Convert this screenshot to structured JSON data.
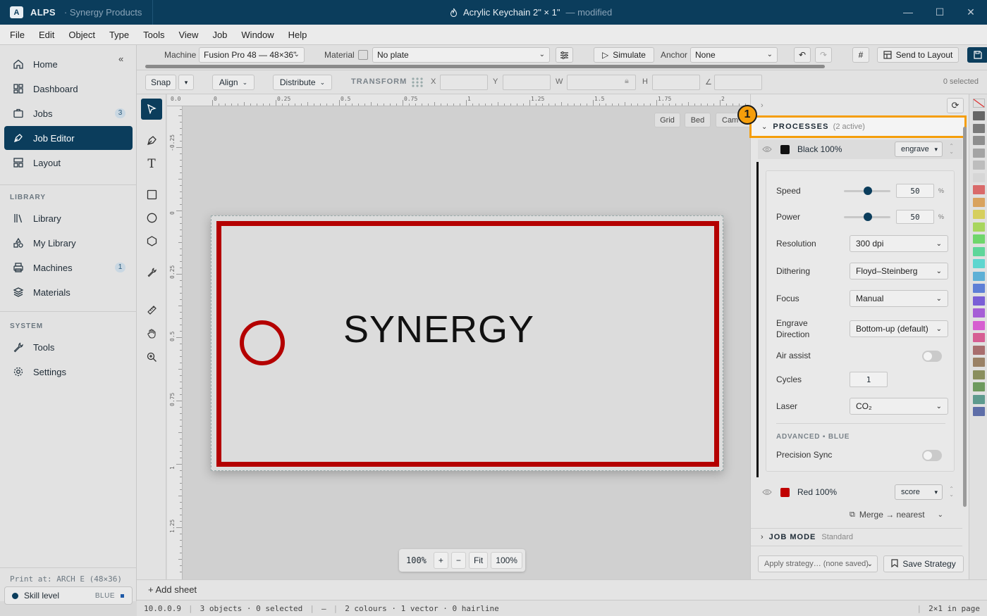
{
  "titlebar": {
    "logo_letter": "A",
    "app_name": "ALPS",
    "org": "· Synergy Products",
    "doc_title": "Acrylic Keychain 2\" × 1\"",
    "doc_status": "— modified"
  },
  "menu": [
    "File",
    "Edit",
    "Object",
    "Type",
    "Tools",
    "View",
    "Job",
    "Window",
    "Help"
  ],
  "sidebar": {
    "main": [
      {
        "label": "Home",
        "icon": "home-icon"
      },
      {
        "label": "Dashboard",
        "icon": "dashboard-icon"
      },
      {
        "label": "Jobs",
        "icon": "jobs-icon",
        "badge": "3"
      },
      {
        "label": "Job Editor",
        "icon": "pen-nib-icon",
        "active": true
      },
      {
        "label": "Layout",
        "icon": "layout-icon"
      }
    ],
    "library_label": "LIBRARY",
    "library": [
      {
        "label": "Library",
        "icon": "books-icon"
      },
      {
        "label": "My Library",
        "icon": "shapes-icon"
      },
      {
        "label": "Machines",
        "icon": "printer-icon",
        "badge": "1"
      },
      {
        "label": "Materials",
        "icon": "layers-icon"
      }
    ],
    "system_label": "SYSTEM",
    "system": [
      {
        "label": "Tools",
        "icon": "wrench-icon"
      },
      {
        "label": "Settings",
        "icon": "gear-icon"
      }
    ],
    "print_at": "Print at: ARCH E (48×36)",
    "skill_label": "Skill level",
    "skill_value": "BLUE"
  },
  "toolbar": {
    "machine_label": "Machine",
    "machine_value": "Fusion Pro 48 — 48×36\"",
    "material_label": "Material",
    "material_value": "No plate",
    "simulate_label": "Simulate",
    "anchor_label": "Anchor",
    "anchor_value": "None",
    "send_label": "Send to Layout"
  },
  "toolbar2": {
    "snap_label": "Snap",
    "align_label": "Align",
    "distribute_label": "Distribute",
    "transform_label": "TRANSFORM",
    "x_label": "X",
    "y_label": "Y",
    "w_label": "W",
    "h_label": "H",
    "angle_label": "∠",
    "selected_count": "0 selected"
  },
  "ruler": {
    "top": [
      "0.0",
      "0",
      "0.25",
      "0.5",
      "0.75",
      "1",
      "1.25",
      "1.5",
      "1.75",
      "2"
    ],
    "left": [
      "-0.25",
      "0",
      "0.25",
      "0.5",
      "0.75",
      "1",
      "1.25"
    ]
  },
  "canvas": {
    "view_chips": [
      "Grid",
      "Bed",
      "Cam"
    ],
    "design_text": "SYNERGY",
    "zoom_value": "100%",
    "zoom_in": "+",
    "zoom_out": "−",
    "fit_label": "Fit",
    "zoom_100": "100%"
  },
  "sheetbar": {
    "add_sheet": "+ Add sheet"
  },
  "status": {
    "version": "10.0.0.9",
    "objects": "3 objects · 0 selected",
    "dash": "—",
    "colours": "2 colours · 1 vector · 0 hairline",
    "layout": "2×1 in page"
  },
  "panel": {
    "callout": "1",
    "processes_title": "PROCESSES",
    "processes_count": "(2 active)",
    "process1": {
      "name": "Black 100%",
      "color": "#111111",
      "mode": "engrave"
    },
    "process2": {
      "name": "Red 100%",
      "color": "#c00000",
      "mode": "score"
    },
    "settings": {
      "speed_label": "Speed",
      "speed_value": "50",
      "speed_unit": "%",
      "power_label": "Power",
      "power_value": "50",
      "power_unit": "%",
      "resolution_label": "Resolution",
      "resolution_value": "300 dpi",
      "dithering_label": "Dithering",
      "dithering_value": "Floyd–Steinberg",
      "focus_label": "Focus",
      "focus_value": "Manual",
      "engrave_dir_label": "Engrave Direction",
      "engrave_dir_value": "Bottom-up (default)",
      "air_assist_label": "Air assist",
      "cycles_label": "Cycles",
      "cycles_value": "1",
      "laser_label": "Laser",
      "laser_value": "CO₂",
      "advanced_label": "ADVANCED ▪ BLUE",
      "precision_label": "Precision Sync"
    },
    "merge_label": "Merge → nearest",
    "job_mode_title": "JOB MODE",
    "job_mode_value": "Standard",
    "strategy_placeholder": "Apply strategy… (none saved)",
    "save_strategy": "Save Strategy"
  },
  "palette": [
    "#e0e0e0",
    "#666666",
    "#7a7a7a",
    "#8e8e8e",
    "#a4a4a4",
    "#bdbdbd",
    "#d6d6d6",
    "#d96a6a",
    "#d9a35e",
    "#d6cf5e",
    "#a8d65e",
    "#6fd66b",
    "#5ed69a",
    "#5ed6cf",
    "#5eb0d6",
    "#5e7fd6",
    "#7a5ed6",
    "#a65ed6",
    "#d65ed0",
    "#d65e93",
    "#a86e6e",
    "#9a8266",
    "#8a8f5e",
    "#6e9a5e",
    "#5e9a8e",
    "#5e6ea8"
  ]
}
